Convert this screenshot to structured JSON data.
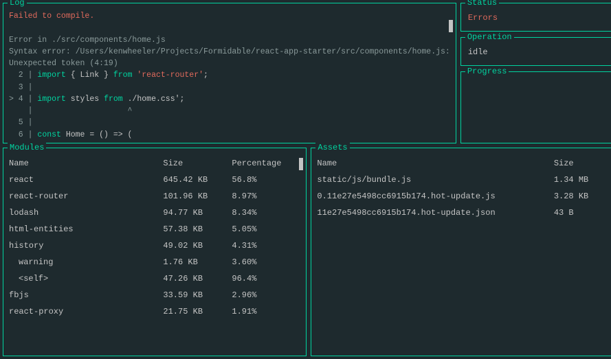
{
  "log": {
    "title": "Log",
    "failMsg": "Failed to compile.",
    "errLine1": "Error in ./src/components/home.js",
    "errLine2": "Syntax error: /Users/kenwheeler/Projects/Formidable/react-app-starter/src/components/home.js:",
    "errLine3": "Unexpected token (4:19)",
    "code": {
      "l2_num": "  2 | ",
      "l2_import": "import",
      "l2_rest1": " { Link } ",
      "l2_from": "from",
      "l2_sp": " ",
      "l2_str": "'react-router'",
      "l2_end": ";",
      "l3": "  3 |",
      "l4_prefix": "> 4 | ",
      "l4_import": "import",
      "l4_rest1": " styles ",
      "l4_from": "from",
      "l4_sp": " ",
      "l4_path": "./home.css'",
      "l4_end": ";",
      "l4_caret": "    |                    ^",
      "l5": "  5 |",
      "l6_num": "  6 | ",
      "l6_const": "const",
      "l6_rest": " Home = () => ("
    }
  },
  "status": {
    "title": "Status",
    "value": "Errors"
  },
  "operation": {
    "title": "Operation",
    "value": "idle"
  },
  "progress": {
    "title": "Progress"
  },
  "modules": {
    "title": "Modules",
    "headers": {
      "name": "Name",
      "size": "Size",
      "pct": "Percentage"
    },
    "rows": [
      {
        "name": "react",
        "size": "645.42 KB",
        "pct": "56.8%",
        "indent": 0
      },
      {
        "name": "react-router",
        "size": "101.96 KB",
        "pct": "8.97%",
        "indent": 0
      },
      {
        "name": "lodash",
        "size": "94.77 KB",
        "pct": "8.34%",
        "indent": 0
      },
      {
        "name": "html-entities",
        "size": "57.38 KB",
        "pct": "5.05%",
        "indent": 0
      },
      {
        "name": "history",
        "size": "49.02 KB",
        "pct": "4.31%",
        "indent": 0
      },
      {
        "name": "warning",
        "size": "1.76 KB",
        "pct": "3.60%",
        "indent": 1
      },
      {
        "name": "<self>",
        "size": "47.26 KB",
        "pct": "96.4%",
        "indent": 1
      },
      {
        "name": "fbjs",
        "size": "33.59 KB",
        "pct": "2.96%",
        "indent": 0
      },
      {
        "name": "react-proxy",
        "size": "21.75 KB",
        "pct": "1.91%",
        "indent": 0
      }
    ]
  },
  "assets": {
    "title": "Assets",
    "headers": {
      "name": "Name",
      "size": "Size"
    },
    "rows": [
      {
        "name": "static/js/bundle.js",
        "size": "1.34 MB"
      },
      {
        "name": "0.11e27e5498cc6915b174.hot-update.js",
        "size": "3.28 KB"
      },
      {
        "name": "11e27e5498cc6915b174.hot-update.json",
        "size": "43 B"
      }
    ]
  }
}
